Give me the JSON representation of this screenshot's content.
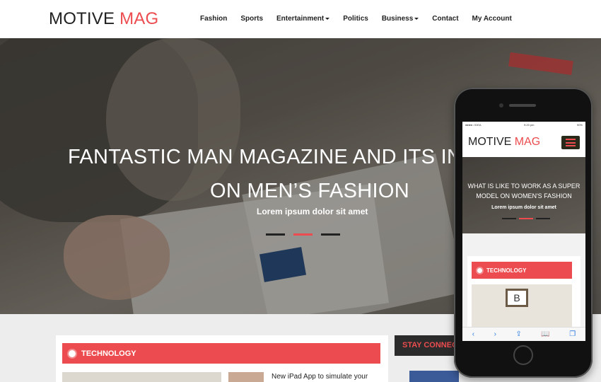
{
  "header": {
    "logo_main": "MOTIVE",
    "logo_accent": "MAG",
    "nav": [
      {
        "label": "Fashion",
        "dropdown": false
      },
      {
        "label": "Sports",
        "dropdown": false
      },
      {
        "label": "Entertainment",
        "dropdown": true
      },
      {
        "label": "Politics",
        "dropdown": false
      },
      {
        "label": "Business",
        "dropdown": true
      },
      {
        "label": "Contact",
        "dropdown": false
      },
      {
        "label": "My Account",
        "dropdown": false
      }
    ]
  },
  "hero": {
    "title_line1": "FANTASTIC MAN MAGAZINE AND ITS IN",
    "title_line2": "ON MEN’S FASHION",
    "subtitle": "Lorem ipsum dolor sit amet",
    "slides": 3,
    "active_slide": 2
  },
  "content": {
    "section_label": "TECHNOLOGY",
    "article_title": "New iPad App to simulate your",
    "stay_connected": "STAY CONNEC"
  },
  "phone": {
    "status_left": "●●●●○ IDEA",
    "status_time": "9:20 pm",
    "status_right": "90%",
    "logo_main": "MOTIVE",
    "logo_accent": "MAG",
    "hero_title": "WHAT IS LIKE TO WORK AS A SUPER MODEL ON WOMEN'S FASHION",
    "hero_subtitle": "Lorem ipsum dolor sit amet",
    "section_label": "TECHNOLOGY",
    "board_letter": "B",
    "toolbar": [
      "‹",
      "›",
      "⇪",
      "📖",
      "❐"
    ]
  },
  "colors": {
    "accent": "#ec4c4f",
    "dark": "#2b2b2b"
  }
}
